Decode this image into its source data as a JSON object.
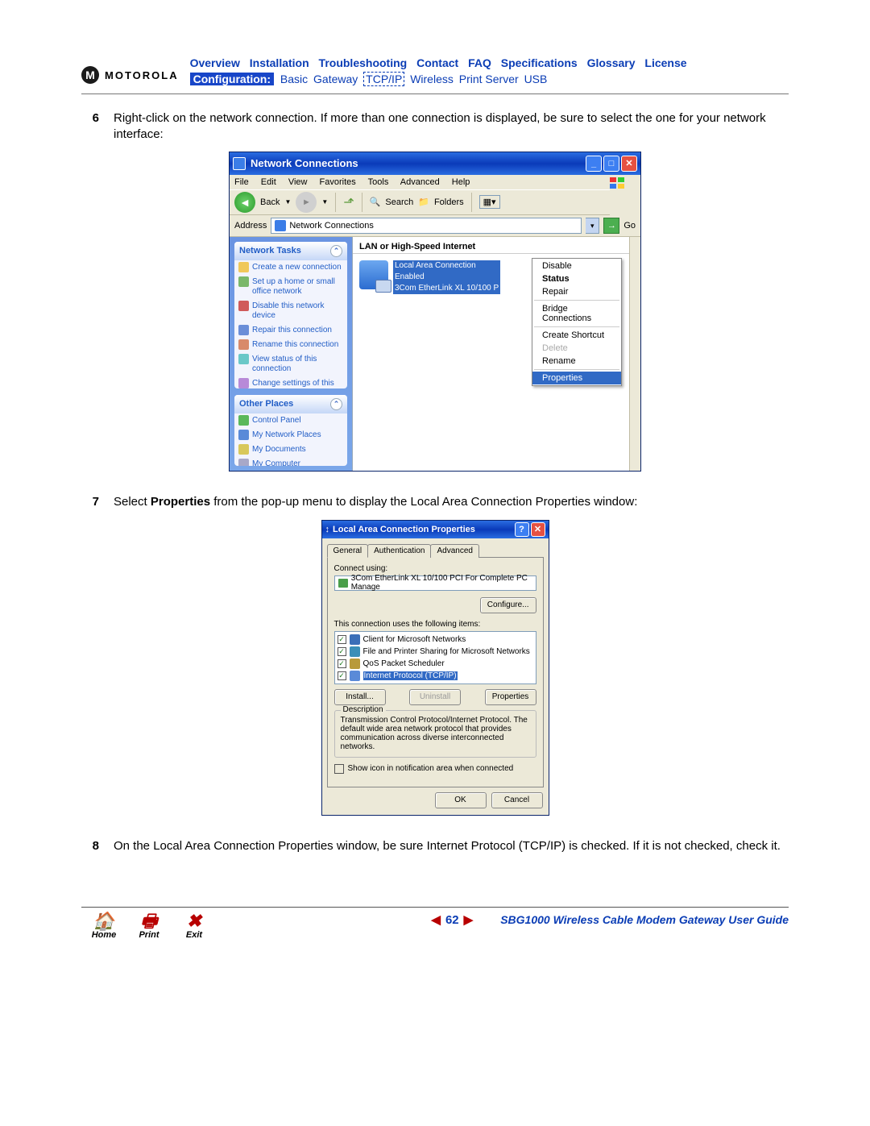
{
  "header": {
    "brand": "MOTOROLA",
    "nav_top": [
      "Overview",
      "Installation",
      "Troubleshooting",
      "Contact",
      "FAQ",
      "Specifications",
      "Glossary",
      "License"
    ],
    "nav_sub_label": "Configuration:",
    "nav_sub": [
      "Basic",
      "Gateway",
      "TCP/IP",
      "Wireless",
      "Print Server",
      "USB"
    ]
  },
  "steps": {
    "s6": {
      "num": "6",
      "text": "Right-click on the network connection. If more than one connection is displayed, be sure to select the one for your network interface:"
    },
    "s7": {
      "num": "7",
      "text_a": "Select ",
      "bold": "Properties",
      "text_b": " from the pop-up menu to display the Local Area Connection Properties window:"
    },
    "s8": {
      "num": "8",
      "text": "On the Local Area Connection Properties window, be sure Internet Protocol (TCP/IP) is checked. If it is not checked, check it."
    }
  },
  "netwin": {
    "title": "Network Connections",
    "menus": [
      "File",
      "Edit",
      "View",
      "Favorites",
      "Tools",
      "Advanced",
      "Help"
    ],
    "back": "Back",
    "search": "Search",
    "folders": "Folders",
    "addr_label": "Address",
    "addr_value": "Network Connections",
    "go": "Go",
    "tasks_hdr": "Network Tasks",
    "tasks": [
      "Create a new connection",
      "Set up a home or small office network",
      "Disable this network device",
      "Repair this connection",
      "Rename this connection",
      "View status of this connection",
      "Change settings of this connection"
    ],
    "other_hdr": "Other Places",
    "other": [
      "Control Panel",
      "My Network Places",
      "My Documents",
      "My Computer"
    ],
    "group": "LAN or High-Speed Internet",
    "conn_name": "Local Area Connection",
    "conn_status": "Enabled",
    "conn_dev": "3Com EtherLink XL 10/100 P",
    "ctx": {
      "disable": "Disable",
      "status": "Status",
      "repair": "Repair",
      "bridge": "Bridge Connections",
      "shortcut": "Create Shortcut",
      "delete": "Delete",
      "rename": "Rename",
      "properties": "Properties"
    }
  },
  "dlg": {
    "title": "Local Area Connection Properties",
    "tabs": [
      "General",
      "Authentication",
      "Advanced"
    ],
    "connect_using": "Connect using:",
    "nic": "3Com EtherLink XL 10/100 PCI For Complete PC Manage",
    "configure": "Configure...",
    "uses": "This connection uses the following items:",
    "items": [
      "Client for Microsoft Networks",
      "File and Printer Sharing for Microsoft Networks",
      "QoS Packet Scheduler",
      "Internet Protocol (TCP/IP)"
    ],
    "install": "Install...",
    "uninstall": "Uninstall",
    "properties": "Properties",
    "desc_hdr": "Description",
    "desc": "Transmission Control Protocol/Internet Protocol. The default wide area network protocol that provides communication across diverse interconnected networks.",
    "show_icon": "Show icon in notification area when connected",
    "ok": "OK",
    "cancel": "Cancel"
  },
  "footer": {
    "home": "Home",
    "print": "Print",
    "exit": "Exit",
    "page": "62",
    "guide": "SBG1000 Wireless Cable Modem Gateway User Guide"
  }
}
